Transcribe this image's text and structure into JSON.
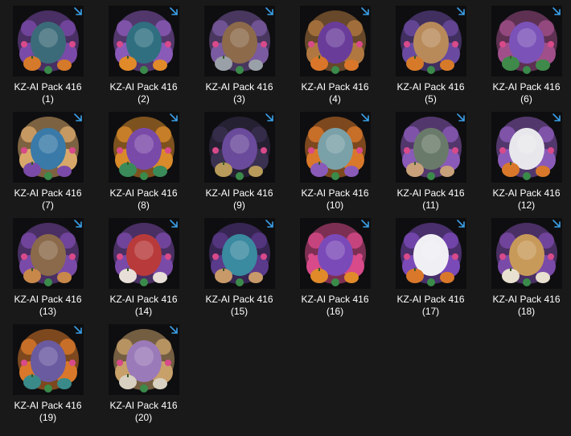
{
  "files": [
    {
      "name": "KZ-AI Pack 416",
      "index": "(1)",
      "icon": "watering-can-pumpkin-icon",
      "palette": [
        "#3b6b78",
        "#7a4aa8",
        "#d5792a"
      ]
    },
    {
      "name": "KZ-AI Pack 416",
      "index": "(2)",
      "icon": "witch-hat-jack-o-lantern-icon",
      "palette": [
        "#2f6f80",
        "#8a5ab8",
        "#e08a2a"
      ]
    },
    {
      "name": "KZ-AI Pack 416",
      "index": "(3)",
      "icon": "teddy-bear-lantern-icon",
      "palette": [
        "#8c6a4a",
        "#7a5aa0",
        "#9aa0a8"
      ]
    },
    {
      "name": "KZ-AI Pack 416",
      "index": "(4)",
      "icon": "witch-doll-wreath-icon",
      "palette": [
        "#6a3c9a",
        "#b07840",
        "#d9762a"
      ]
    },
    {
      "name": "KZ-AI Pack 416",
      "index": "(5)",
      "icon": "puppy-pumpkins-icon",
      "palette": [
        "#b88a5a",
        "#6a4aa0",
        "#d67a2a"
      ]
    },
    {
      "name": "KZ-AI Pack 416",
      "index": "(6)",
      "icon": "flower-pot-bouquet-icon",
      "palette": [
        "#7a52b8",
        "#a04f8a",
        "#3f8a4a"
      ]
    },
    {
      "name": "KZ-AI Pack 416",
      "index": "(7)",
      "icon": "witch-girl-sitting-icon",
      "palette": [
        "#3a7aa8",
        "#d8a86a",
        "#7a4aa8"
      ]
    },
    {
      "name": "KZ-AI Pack 416",
      "index": "(8)",
      "icon": "stacked-pumpkins-icon",
      "palette": [
        "#7a4aa8",
        "#d98a2a",
        "#3a8a5a"
      ]
    },
    {
      "name": "KZ-AI Pack 416",
      "index": "(9)",
      "icon": "ornate-table-icon",
      "palette": [
        "#6a4a9a",
        "#3a3050",
        "#b89a5a"
      ]
    },
    {
      "name": "KZ-AI Pack 416",
      "index": "(10)",
      "icon": "lattes-pumpkin-candles-icon",
      "palette": [
        "#7aa0a8",
        "#d9782a",
        "#8a5ab8"
      ]
    },
    {
      "name": "KZ-AI Pack 416",
      "index": "(11)",
      "icon": "gnome-potions-icon",
      "palette": [
        "#6a7a6a",
        "#8a5ab8",
        "#c8a07a"
      ]
    },
    {
      "name": "KZ-AI Pack 416",
      "index": "(12)",
      "icon": "ghost-witch-hat-icon",
      "palette": [
        "#e8e8ec",
        "#8a5ab8",
        "#d9782a"
      ]
    },
    {
      "name": "KZ-AI Pack 416",
      "index": "(13)",
      "icon": "tree-stump-mushrooms-icon",
      "palette": [
        "#8a6a4a",
        "#7a4aa8",
        "#c8884a"
      ]
    },
    {
      "name": "KZ-AI Pack 416",
      "index": "(14)",
      "icon": "gnome-grapes-icon",
      "palette": [
        "#b83a3a",
        "#7a4aa8",
        "#e8e0d8"
      ]
    },
    {
      "name": "KZ-AI Pack 416",
      "index": "(15)",
      "icon": "cupcakes-roses-icon",
      "palette": [
        "#3a8aa0",
        "#5a3a8a",
        "#c89a6a"
      ]
    },
    {
      "name": "KZ-AI Pack 416",
      "index": "(16)",
      "icon": "cauldron-flowers-icon",
      "palette": [
        "#7a4ab8",
        "#d84a8a",
        "#e08a2a"
      ]
    },
    {
      "name": "KZ-AI Pack 416",
      "index": "(17)",
      "icon": "snowman-purple-hat-icon",
      "palette": [
        "#f0f0f4",
        "#7a4ab8",
        "#d9782a"
      ]
    },
    {
      "name": "KZ-AI Pack 416",
      "index": "(18)",
      "icon": "lantern-skull-icon",
      "palette": [
        "#c89a5a",
        "#7a4aa8",
        "#e8e0d0"
      ]
    },
    {
      "name": "KZ-AI Pack 416",
      "index": "(19)",
      "icon": "potion-shelf-pumpkin-icon",
      "palette": [
        "#6a5aa0",
        "#d9782a",
        "#3a8a8a"
      ]
    },
    {
      "name": "KZ-AI Pack 416",
      "index": "(20)",
      "icon": "skeleton-goblet-icon",
      "palette": [
        "#9a7ab8",
        "#c8a06a",
        "#d8d0c0"
      ]
    }
  ],
  "shortcut_icon": "shortcut-arrow-icon",
  "colors": {
    "background": "#191919",
    "shortcut_arrow": "#3aa0e8",
    "label_text": "#ffffff"
  }
}
